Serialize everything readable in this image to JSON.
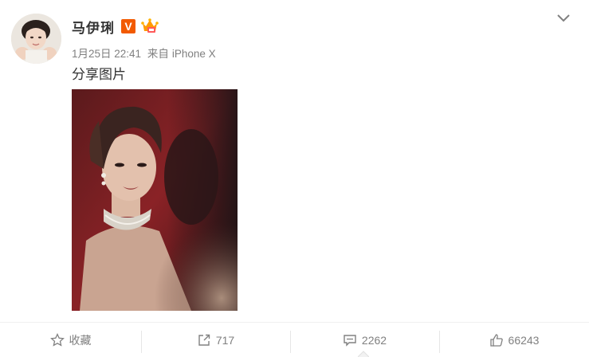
{
  "author": {
    "name": "马伊琍",
    "verified_label": "V"
  },
  "post": {
    "time": "1月25日 22:41",
    "source_prefix": "来自",
    "source_device": "iPhone X",
    "text": "分享图片"
  },
  "actions": {
    "favorite_label": "收藏",
    "repost_count": "717",
    "comment_count": "2262",
    "like_count": "66243"
  },
  "icons": [
    "crown-icon",
    "chevron-down-icon",
    "star-icon",
    "share-icon",
    "comment-icon",
    "thumbs-up-icon"
  ],
  "colors": {
    "verified_badge": "#f25a00",
    "crown": "#ff9a00",
    "meta_text": "#808080",
    "name_text": "#333333"
  }
}
